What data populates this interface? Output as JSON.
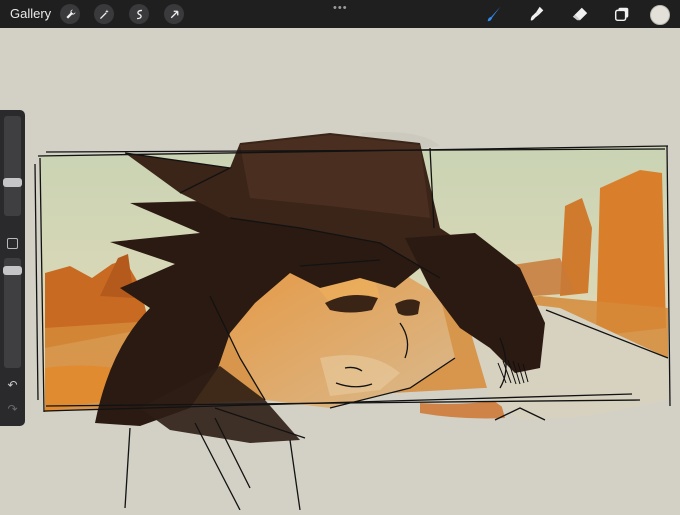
{
  "toolbar": {
    "gallery_label": "Gallery",
    "left_tools": [
      "wrench-icon",
      "magic-wand-icon",
      "selection-icon",
      "transform-icon"
    ],
    "right_tools": [
      "brush-icon",
      "smudge-icon",
      "eraser-icon",
      "layers-icon",
      "color-swatch"
    ],
    "active_tool": "brush",
    "active_color": "#e3e0d9",
    "accent": "#2f8cf0"
  },
  "sidebar": {
    "size_slider_level": 0.45,
    "opacity_slider_level": 0.3,
    "buttons": [
      "modify-square-icon",
      "undo-icon",
      "redo-icon"
    ]
  },
  "canvas": {
    "background": "#d3d1c6",
    "artwork": "sketch-of-cowboy-in-desert-panel"
  }
}
